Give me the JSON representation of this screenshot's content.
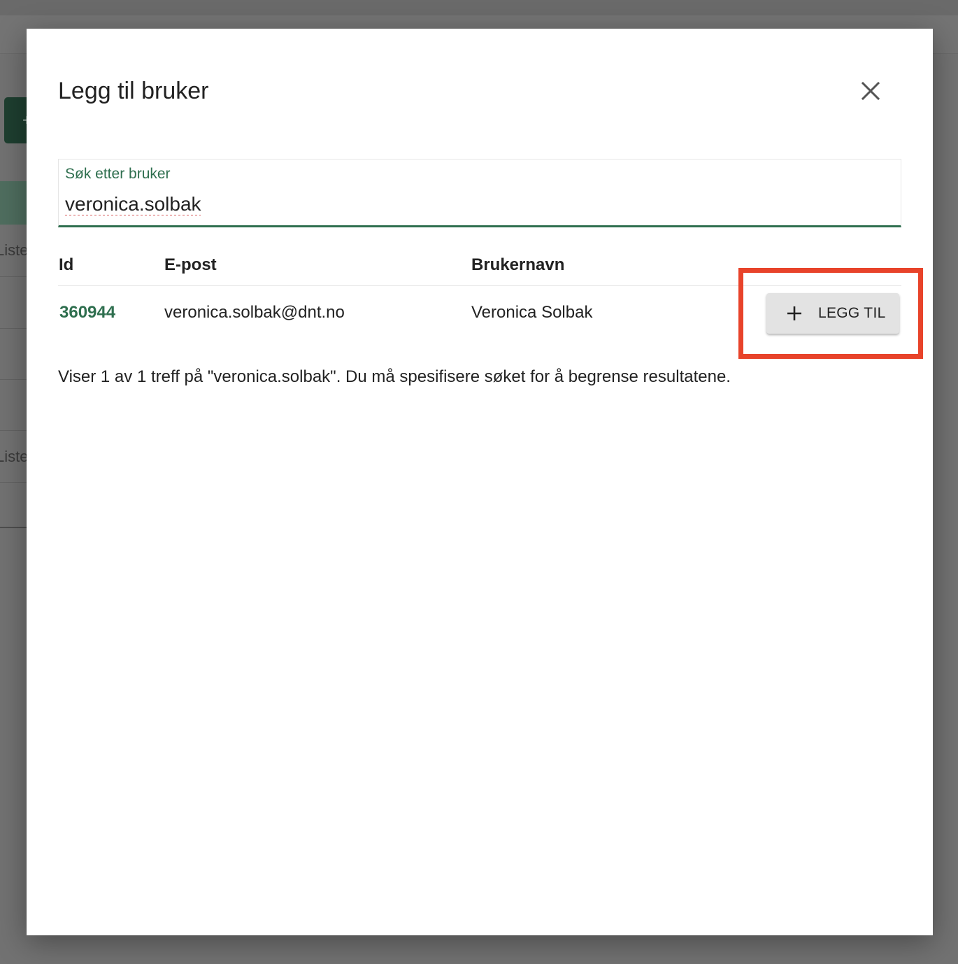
{
  "background": {
    "row_labels": [
      "Liste",
      "Liste"
    ]
  },
  "dialog": {
    "title": "Legg til bruker",
    "close_icon": "close-icon",
    "search": {
      "label": "Søk etter bruker",
      "value": "veronica.solbak"
    },
    "table": {
      "headers": {
        "id": "Id",
        "email": "E-post",
        "username": "Brukernavn"
      },
      "rows": [
        {
          "id": "360944",
          "email": "veronica.solbak@dnt.no",
          "username": "Veronica Solbak",
          "action_label": "LEGG TIL",
          "action_icon": "plus-icon"
        }
      ]
    },
    "summary": "Viser 1 av 1 treff på \"veronica.solbak\". Du må spesifisere søket for å begrense resultatene."
  },
  "colors": {
    "accent": "#2f6f4f",
    "highlight": "#e8432a",
    "overlay": "#727272"
  }
}
